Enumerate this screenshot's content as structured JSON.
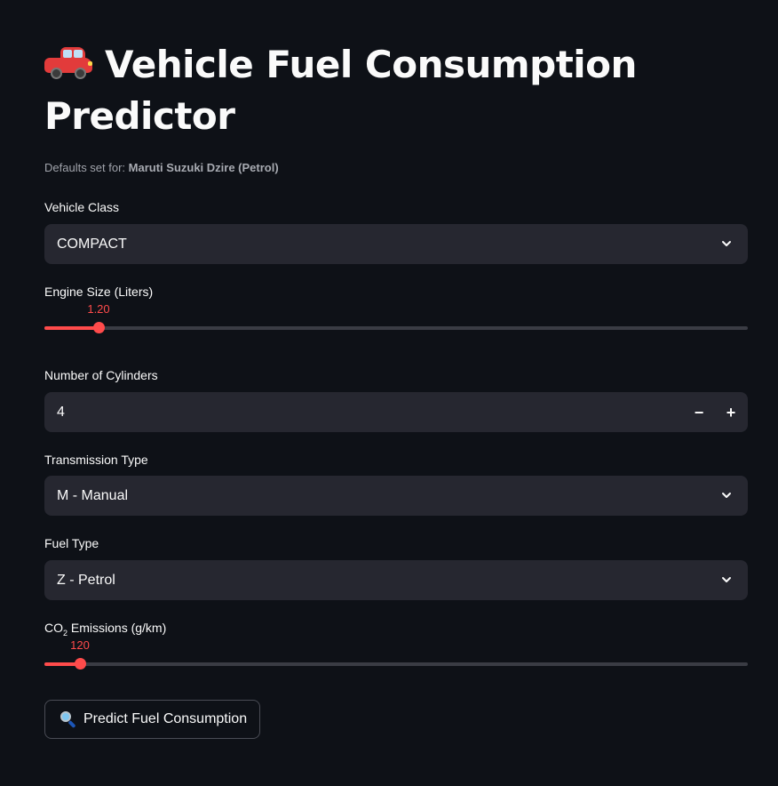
{
  "header": {
    "title": "Vehicle Fuel Consumption Predictor",
    "emoji_icon": "red-car-icon"
  },
  "caption": {
    "prefix": "Defaults set for: ",
    "vehicle": "Maruti Suzuki Dzire (Petrol)"
  },
  "fields": {
    "vehicle_class": {
      "label": "Vehicle Class",
      "value": "COMPACT"
    },
    "engine_size": {
      "label": "Engine Size (Liters)",
      "value": "1.20",
      "fraction": 0.077
    },
    "cylinders": {
      "label": "Number of Cylinders",
      "value": "4",
      "minus": "−",
      "plus": "+"
    },
    "transmission": {
      "label": "Transmission Type",
      "value": "M - Manual"
    },
    "fuel_type": {
      "label": "Fuel Type",
      "value": "Z - Petrol"
    },
    "co2": {
      "label_prefix": "CO",
      "label_sub": "2",
      "label_suffix": " Emissions (g/km)",
      "value": "120",
      "fraction": 0.05
    }
  },
  "predict_button": {
    "label": "Predict Fuel Consumption",
    "icon": "magnifying-glass-icon"
  },
  "colors": {
    "background": "#0e1117",
    "input_bg": "#262730",
    "accent": "#ff4b4b",
    "text": "#fafafa",
    "muted": "#a0a3ab"
  }
}
